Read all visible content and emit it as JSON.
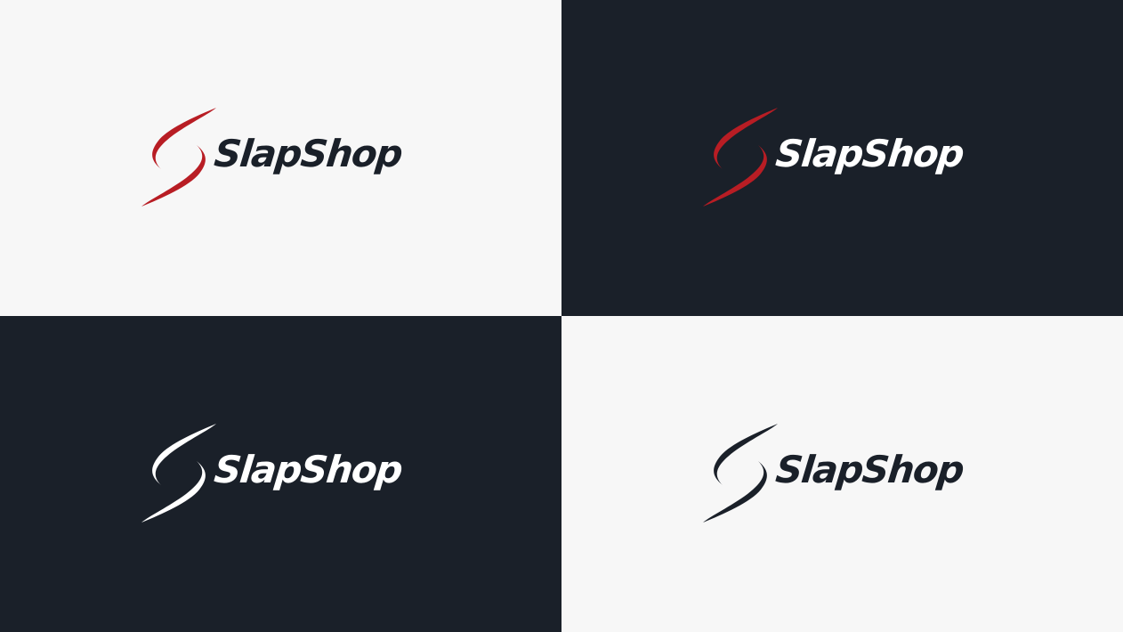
{
  "brand": {
    "name": "SlapShop"
  },
  "colors": {
    "light_bg": "#f7f7f7",
    "dark_bg": "#1a2029",
    "red": "#b81d24",
    "white": "#ffffff",
    "navy": "#1a2029"
  },
  "panels": [
    {
      "id": "light-red",
      "background": "#f7f7f7",
      "mark_color": "#b81d24",
      "text_color": "#1a2029"
    },
    {
      "id": "dark-red",
      "background": "#1a2029",
      "mark_color": "#b81d24",
      "text_color": "#ffffff"
    },
    {
      "id": "dark-white",
      "background": "#1a2029",
      "mark_color": "#ffffff",
      "text_color": "#ffffff"
    },
    {
      "id": "light-navy",
      "background": "#f7f7f7",
      "mark_color": "#1a2029",
      "text_color": "#1a2029"
    }
  ]
}
